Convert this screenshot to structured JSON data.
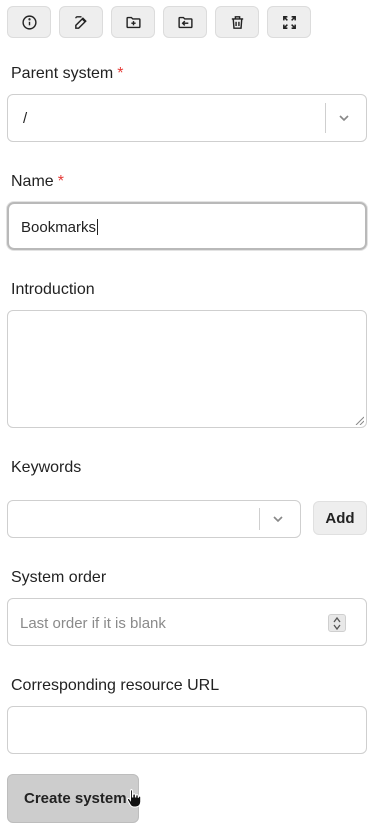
{
  "toolbar": {
    "icons": [
      "info-icon",
      "edit-icon",
      "folder-add-icon",
      "folder-move-icon",
      "trash-icon",
      "expand-icon"
    ]
  },
  "form": {
    "parent_system": {
      "label": "Parent system",
      "required_mark": "*",
      "value": "/"
    },
    "name": {
      "label": "Name",
      "required_mark": "*",
      "value": "Bookmarks"
    },
    "introduction": {
      "label": "Introduction",
      "value": ""
    },
    "keywords": {
      "label": "Keywords",
      "value": "",
      "add_label": "Add"
    },
    "system_order": {
      "label": "System order",
      "placeholder": "Last order if it is blank"
    },
    "resource_url": {
      "label": "Corresponding resource URL",
      "value": ""
    },
    "submit_label": "Create system"
  }
}
